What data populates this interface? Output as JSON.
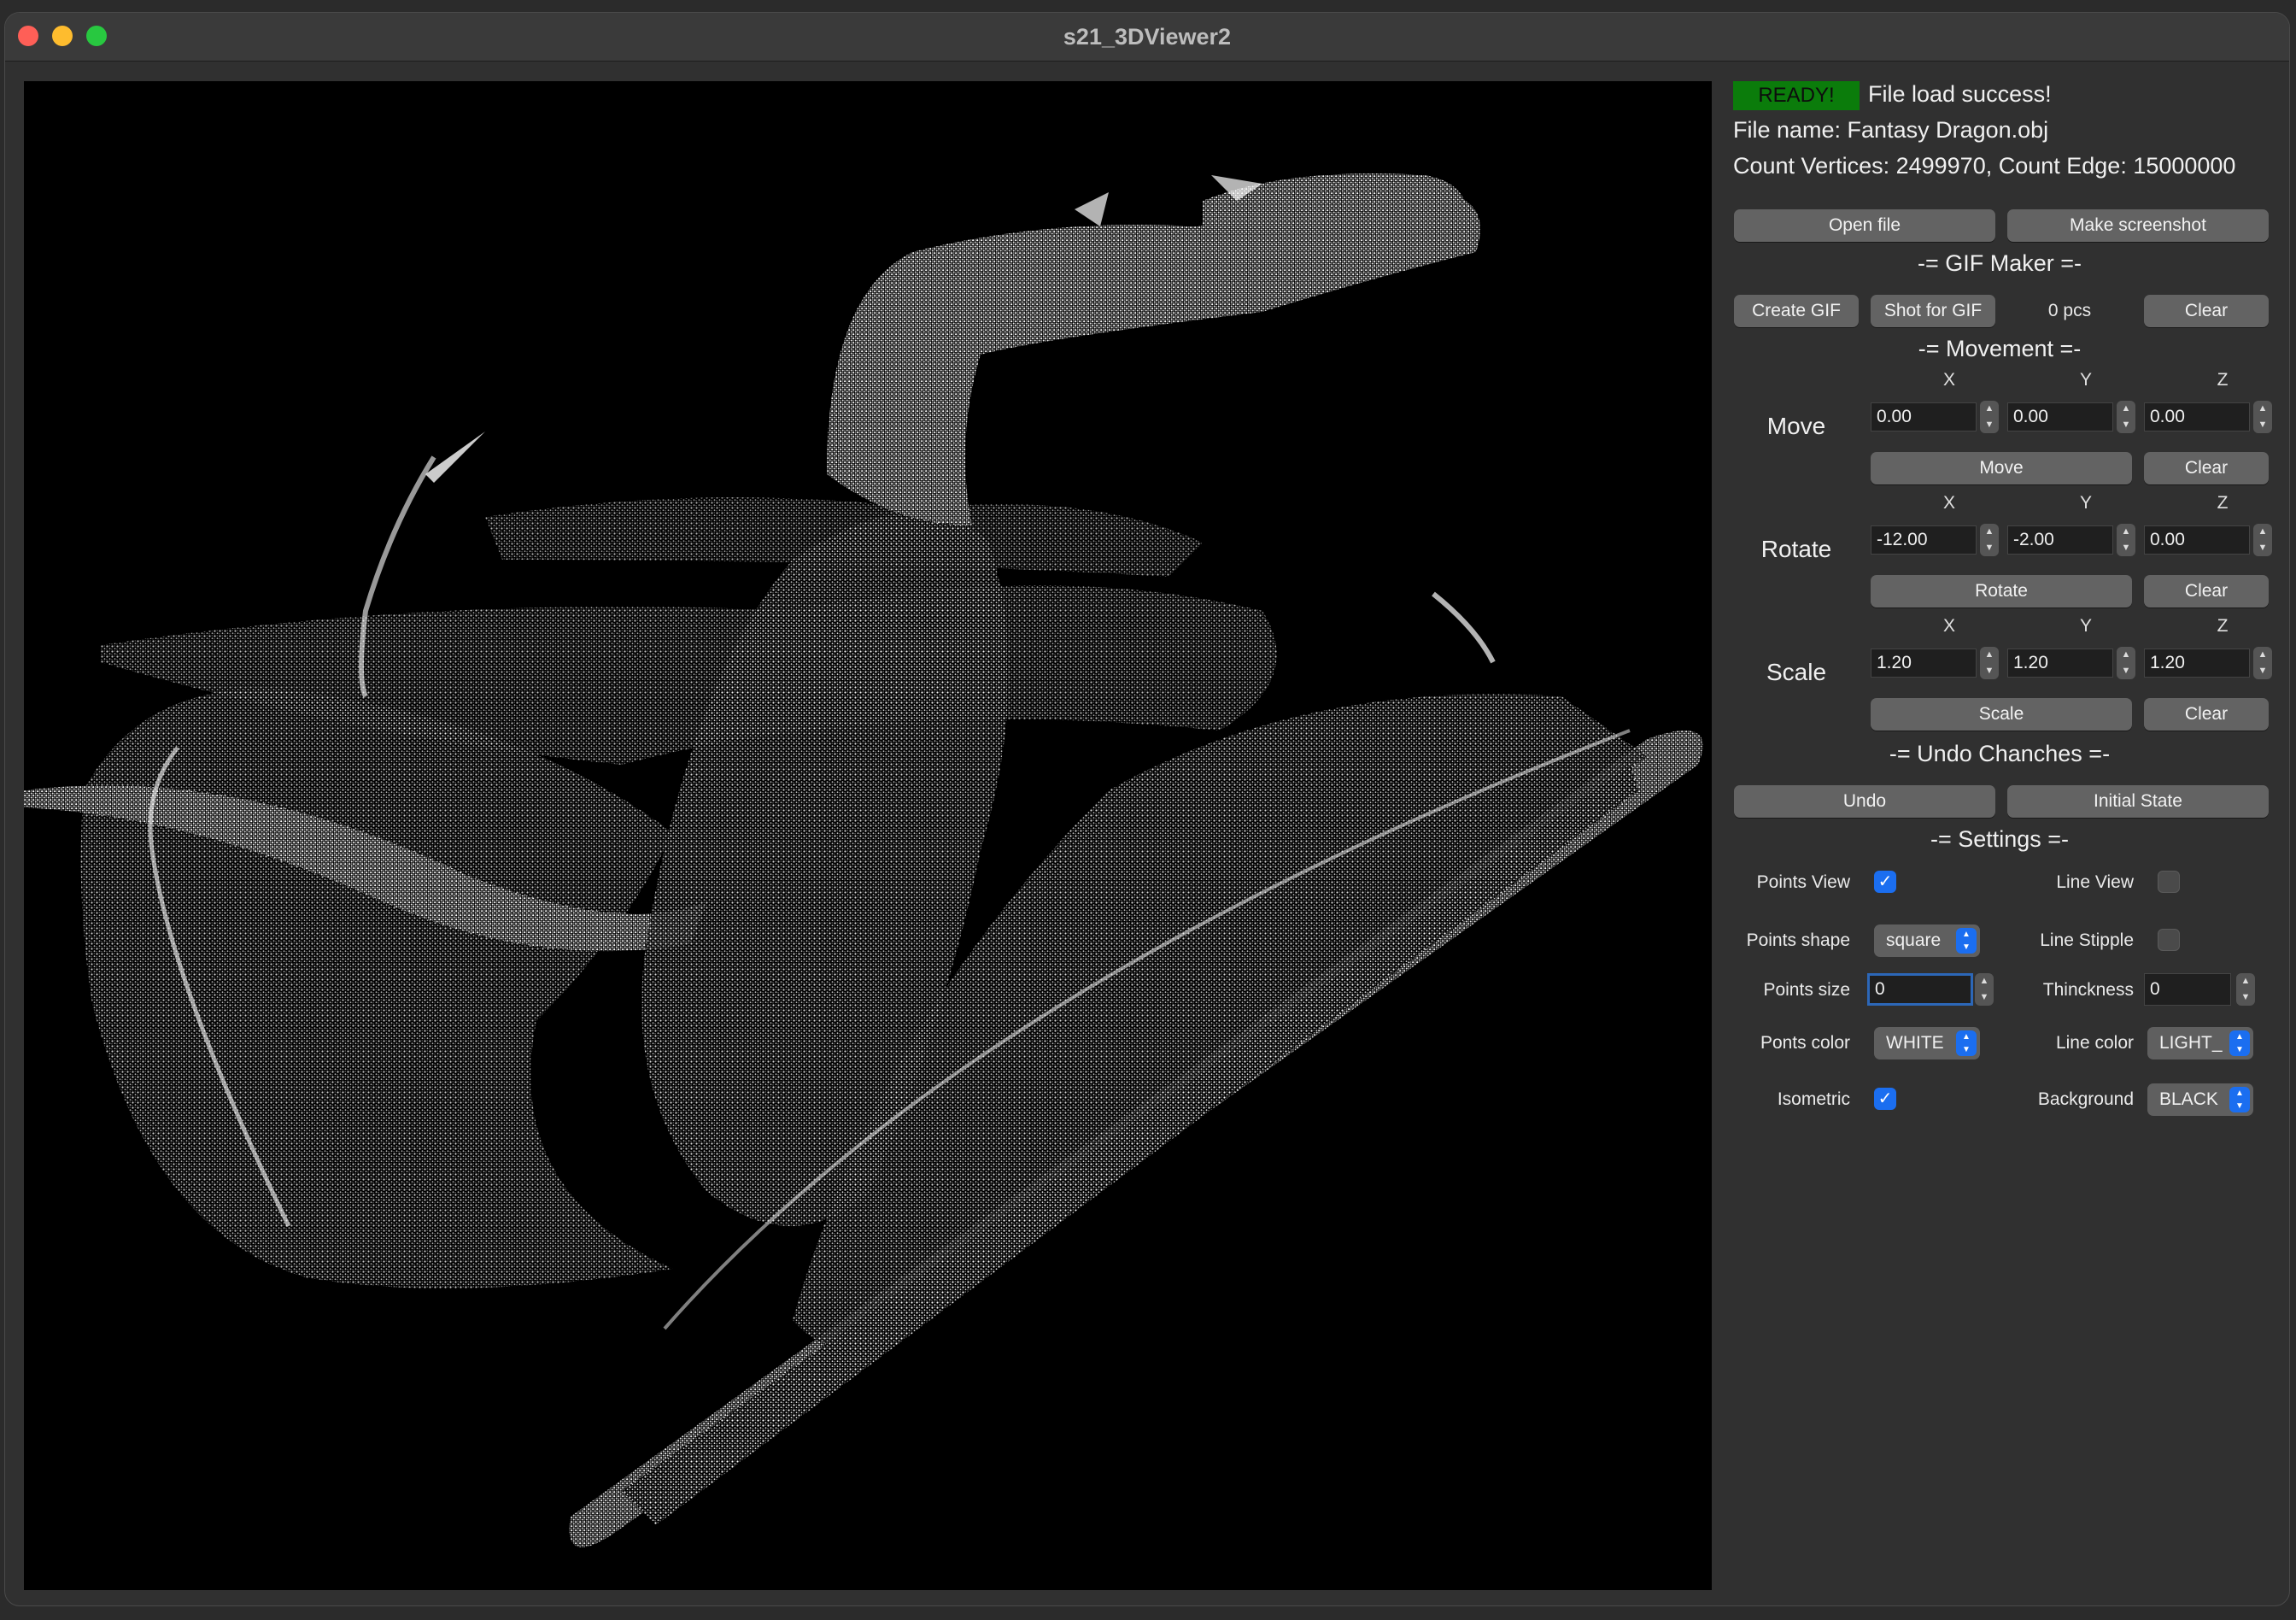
{
  "window": {
    "title": "s21_3DViewer2"
  },
  "status": {
    "badge": "READY!",
    "message": "File load success!",
    "file_name": "File name: Fantasy Dragon.obj",
    "counts": "Count Vertices: 2499970, Count Edge: 15000000"
  },
  "file_buttons": {
    "open": "Open file",
    "screenshot": "Make screenshot"
  },
  "gif": {
    "title": "-= GIF Maker =-",
    "create": "Create GIF",
    "shot": "Shot for GIF",
    "count": "0 pcs",
    "clear": "Clear"
  },
  "movement": {
    "title": "-= Movement =-",
    "axes": [
      "X",
      "Y",
      "Z"
    ],
    "move": {
      "label": "Move",
      "values": [
        "0.00",
        "0.00",
        "0.00"
      ],
      "button": "Move",
      "clear": "Clear"
    },
    "rotate": {
      "label": "Rotate",
      "values": [
        "-12.00",
        "-2.00",
        "0.00"
      ],
      "button": "Rotate",
      "clear": "Clear"
    },
    "scale": {
      "label": "Scale",
      "values": [
        "1.20",
        "1.20",
        "1.20"
      ],
      "button": "Scale",
      "clear": "Clear"
    }
  },
  "undo": {
    "title": "-= Undo Chanches =-",
    "undo": "Undo",
    "initial": "Initial State"
  },
  "settings": {
    "title": "-= Settings =-",
    "points_view": {
      "label": "Points View",
      "checked": true
    },
    "line_view": {
      "label": "Line View",
      "checked": false
    },
    "points_shape": {
      "label": "Points shape",
      "value": "square"
    },
    "line_stipple": {
      "label": "Line Stipple",
      "checked": false
    },
    "points_size": {
      "label": "Points size",
      "value": "0"
    },
    "thickness": {
      "label": "Thinckness",
      "value": "0"
    },
    "points_color": {
      "label": "Ponts color",
      "value": "WHITE"
    },
    "line_color": {
      "label": "Line color",
      "value": "LIGHT_"
    },
    "isometric": {
      "label": "Isometric",
      "checked": true
    },
    "background": {
      "label": "Background",
      "value": "BLACK"
    }
  },
  "colors": {
    "status_green": "#0b7c0b",
    "accent_blue": "#1b6ef0",
    "viewport_bg": "#000000"
  }
}
